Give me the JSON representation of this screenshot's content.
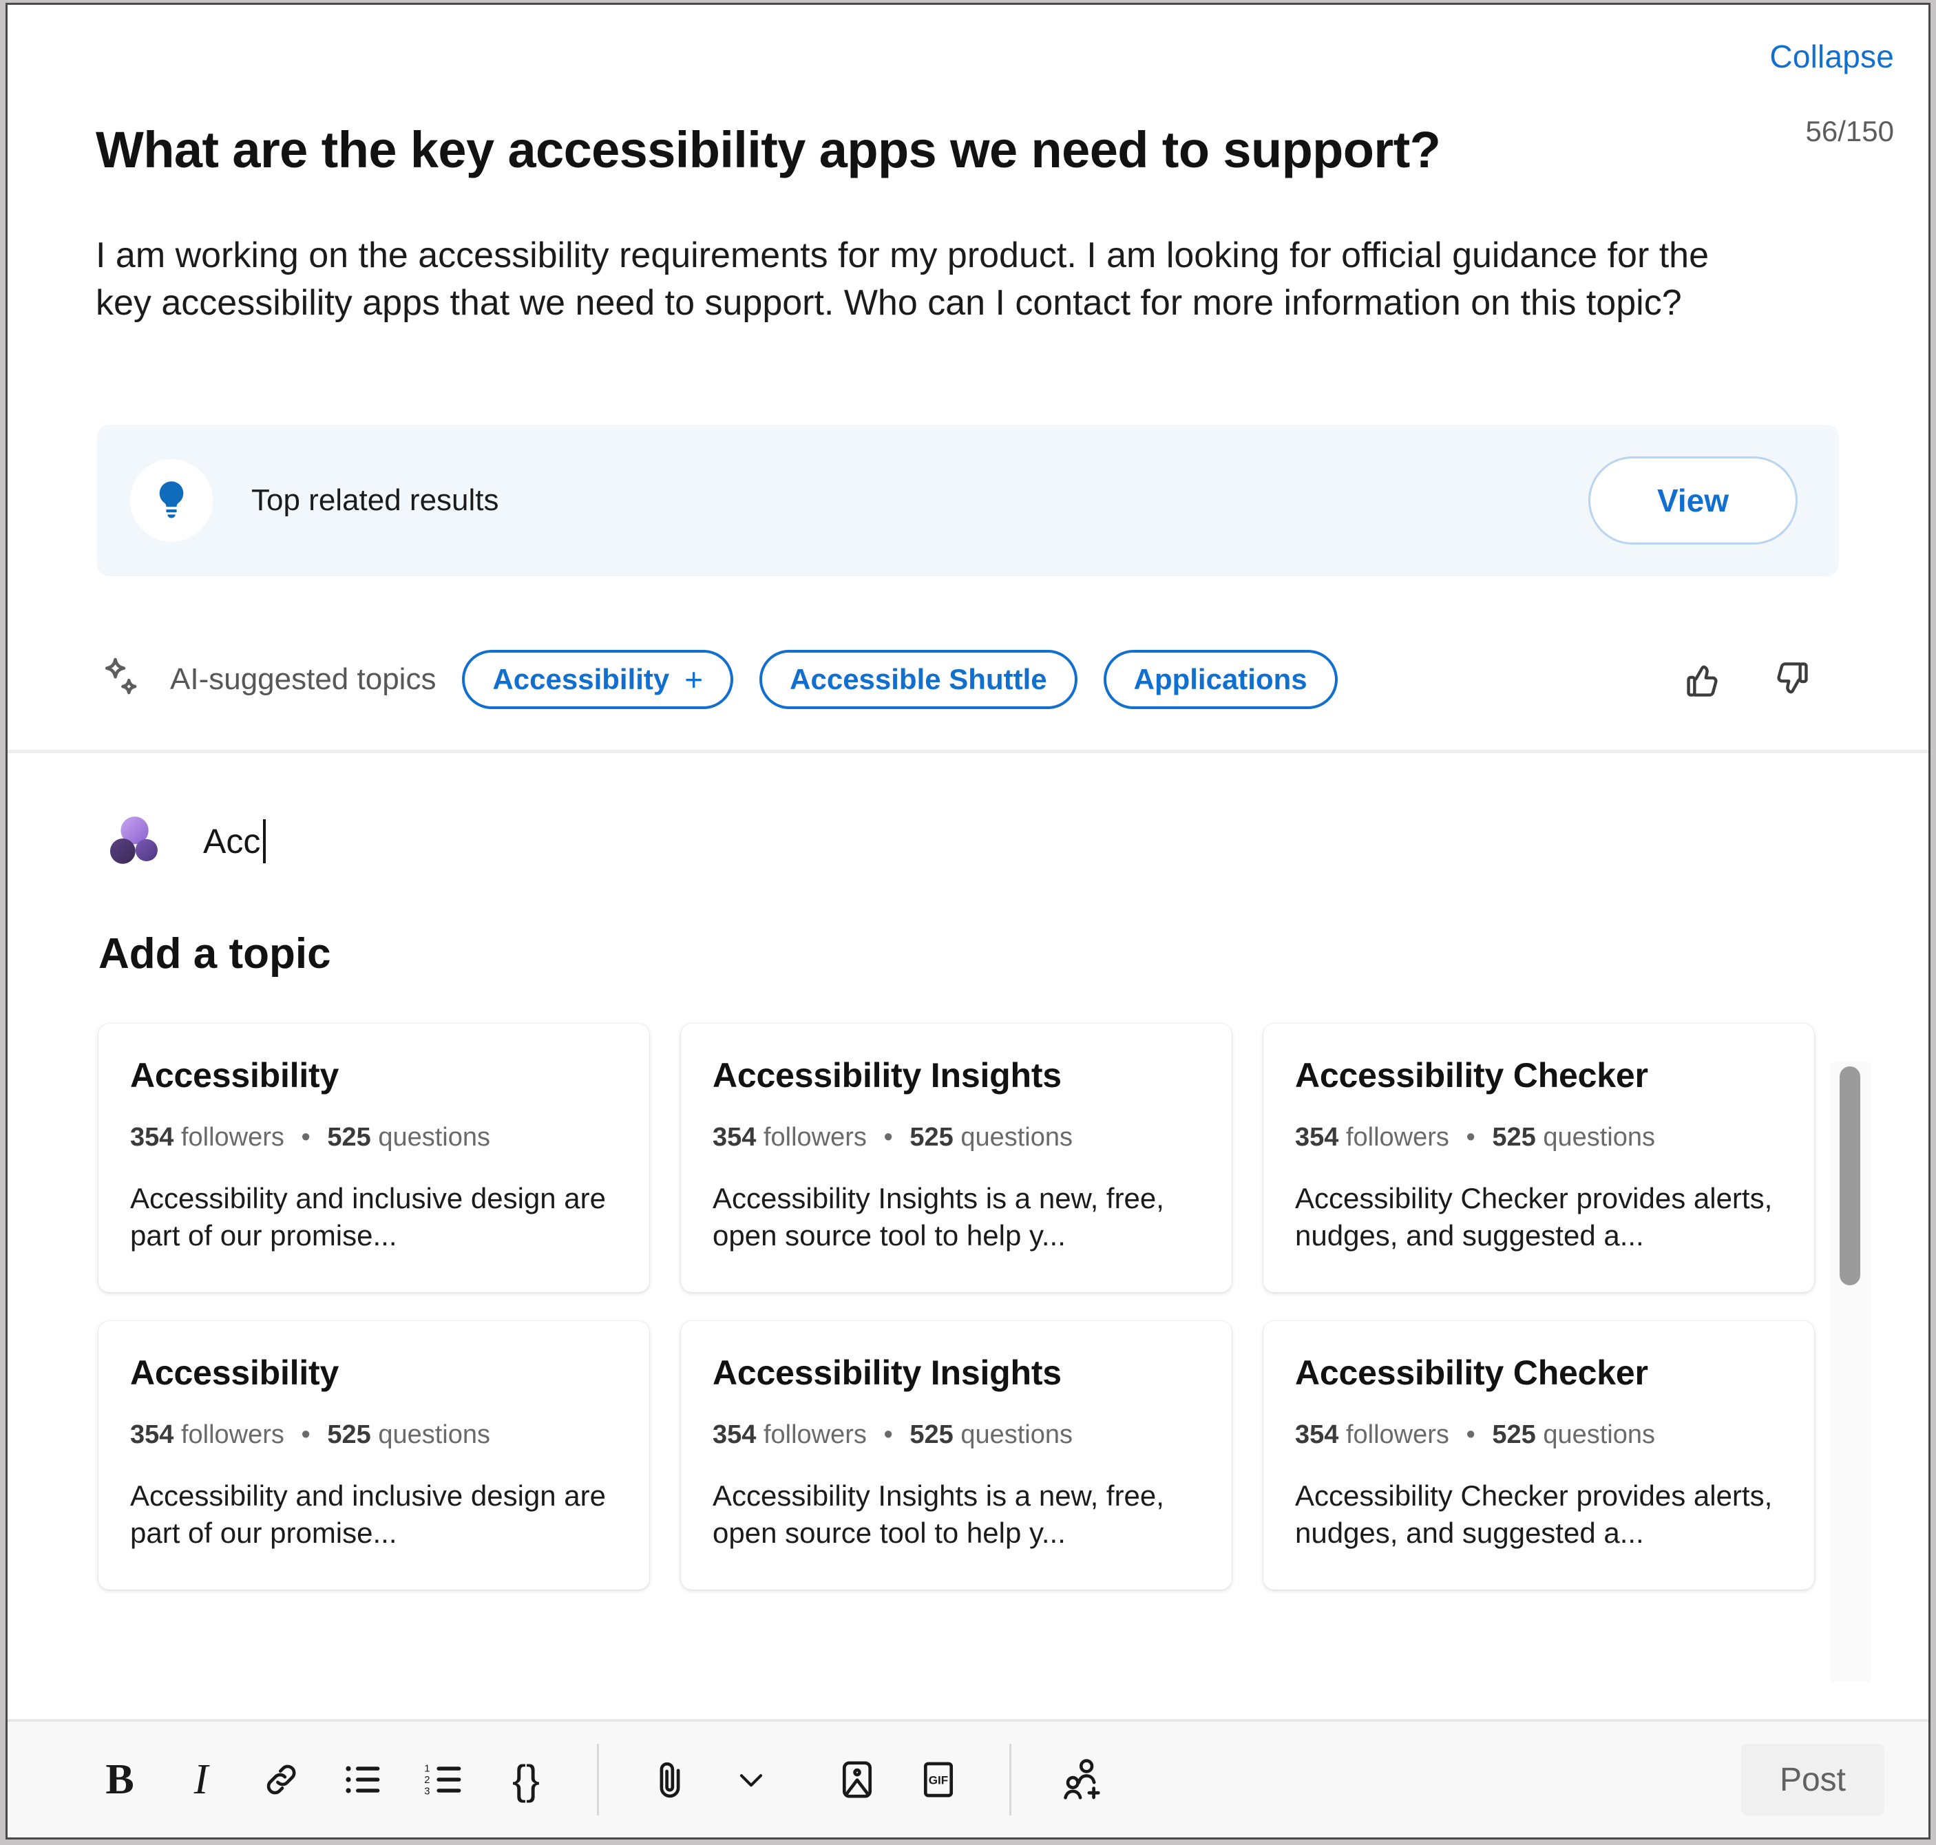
{
  "header": {
    "collapse_label": "Collapse",
    "char_counter": "56/150"
  },
  "question": {
    "title": "What are the key accessibility apps we need to support?",
    "body": "I am working on the accessibility requirements for my product. I am looking for official guidance for the key accessibility apps that we need to support. Who can I contact for more information on this topic?"
  },
  "related_banner": {
    "icon": "lightbulb-icon",
    "label": "Top related results",
    "action_label": "View"
  },
  "ai_topics": {
    "icon": "sparkle-icon",
    "label": "AI-suggested topics",
    "chips": [
      {
        "label": "Accessibility",
        "has_add": true,
        "add_glyph": "+"
      },
      {
        "label": "Accessible Shuttle",
        "has_add": false
      },
      {
        "label": "Applications",
        "has_add": false
      }
    ],
    "reactions": [
      "thumbs-up-icon",
      "thumbs-down-icon"
    ]
  },
  "topic_picker": {
    "avatar_icon": "viva-topics-icon",
    "input_value": "Acc",
    "input_placeholder": "Add a topic",
    "heading": "Add a topic",
    "cards": [
      {
        "title": "Accessibility",
        "followers_count": "354",
        "followers_label": "followers",
        "separator": "•",
        "questions_count": "525",
        "questions_label": "questions",
        "description": "Accessibility and inclusive design are part of our promise..."
      },
      {
        "title": "Accessibility Insights",
        "followers_count": "354",
        "followers_label": "followers",
        "separator": "•",
        "questions_count": "525",
        "questions_label": "questions",
        "description": "Accessibility Insights is a new, free, open source tool to help y..."
      },
      {
        "title": "Accessibility Checker",
        "followers_count": "354",
        "followers_label": "followers",
        "separator": "•",
        "questions_count": "525",
        "questions_label": "questions",
        "description": "Accessibility Checker provides alerts, nudges, and suggested a..."
      },
      {
        "title": "Accessibility",
        "followers_count": "354",
        "followers_label": "followers",
        "separator": "•",
        "questions_count": "525",
        "questions_label": "questions",
        "description": "Accessibility and inclusive design are part of our promise..."
      },
      {
        "title": "Accessibility Insights",
        "followers_count": "354",
        "followers_label": "followers",
        "separator": "•",
        "questions_count": "525",
        "questions_label": "questions",
        "description": "Accessibility Insights is a new, free, open source tool to help y..."
      },
      {
        "title": "Accessibility Checker",
        "followers_count": "354",
        "followers_label": "followers",
        "separator": "•",
        "questions_count": "525",
        "questions_label": "questions",
        "description": "Accessibility Checker provides alerts, nudges, and suggested a..."
      }
    ]
  },
  "toolbar": {
    "items": [
      {
        "name": "bold-icon",
        "glyph": "B"
      },
      {
        "name": "italic-icon",
        "glyph": "I"
      },
      {
        "name": "link-icon",
        "glyph": ""
      },
      {
        "name": "bulleted-list-icon",
        "glyph": ""
      },
      {
        "name": "numbered-list-icon",
        "glyph": ""
      },
      {
        "name": "code-icon",
        "glyph": "{}"
      },
      {
        "name": "attach-icon",
        "glyph": ""
      },
      {
        "name": "chevron-down-icon",
        "glyph": ""
      },
      {
        "name": "image-icon",
        "glyph": ""
      },
      {
        "name": "gif-icon",
        "glyph": "GIF"
      },
      {
        "name": "add-people-icon",
        "glyph": ""
      }
    ],
    "post_label": "Post"
  },
  "colors": {
    "accent_blue": "#1170cf",
    "banner_bg": "#f2f7fc",
    "toolbar_bg": "#f8f8f8",
    "muted_text": "#6a6a6a"
  }
}
